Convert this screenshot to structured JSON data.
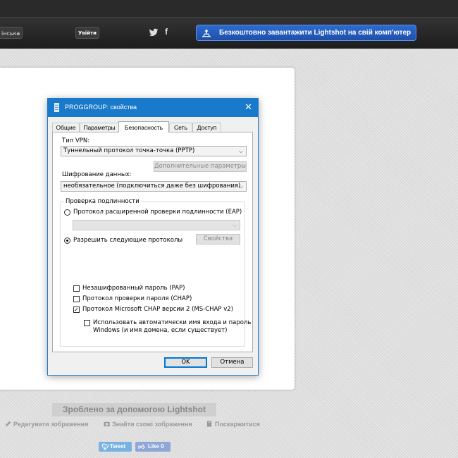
{
  "nav": {
    "lang_label": "інська",
    "login_label": "Увійти",
    "download_label": "Безкоштовно завантажити Lightshot на свій комп'ютер"
  },
  "dialog": {
    "title": "PROGGROUP: свойства",
    "tabs": [
      "Общие",
      "Параметры",
      "Безопасность",
      "Сеть",
      "Доступ"
    ],
    "active_tab": "Безопасность",
    "vpn_type_label": "Тип VPN:",
    "vpn_type_value": "Туннельный протокол точка-точка (PPTP)",
    "advanced_button": "Дополнительные параметры",
    "encryption_label": "Шифрование данных:",
    "encryption_value": "необязательное (подключиться даже без шифрования)",
    "auth_group_label": "Проверка подлинности",
    "eap_radio_label": "Протокол расширенной проверки подлинности (EAP)",
    "eap_radio_checked": false,
    "allow_protocols_label": "Разрешить следующие протоколы",
    "allow_protocols_checked": true,
    "properties_button": "Свойства",
    "protocols": [
      {
        "label": "Незашифрованный пароль (PAP)",
        "checked": false
      },
      {
        "label": "Протокол проверки пароля (CHAP)",
        "checked": false
      },
      {
        "label": "Протокол Microsoft CHAP версии 2 (MS-CHAP v2)",
        "checked": true
      }
    ],
    "autologon_line1": "Использовать автоматически имя входа и пароль",
    "autologon_line2": "Windows (и имя домена, если существует)",
    "autologon_checked": false,
    "ok_button": "OK",
    "cancel_button": "Отмена"
  },
  "footer": {
    "made_with": "Зроблено за допомогою Lightshot",
    "edit_label": "Редагувати зображення",
    "similar_label": "Знайти схожі зображення",
    "report_label": "Поскаржитися",
    "tweet_label": "Tweet",
    "like_label": "Like 0"
  },
  "colors": {
    "titlebar": "#1979ca",
    "download_button": "#2d6bd1",
    "tweet": "#79b2e0",
    "like": "#8fa7d6"
  }
}
